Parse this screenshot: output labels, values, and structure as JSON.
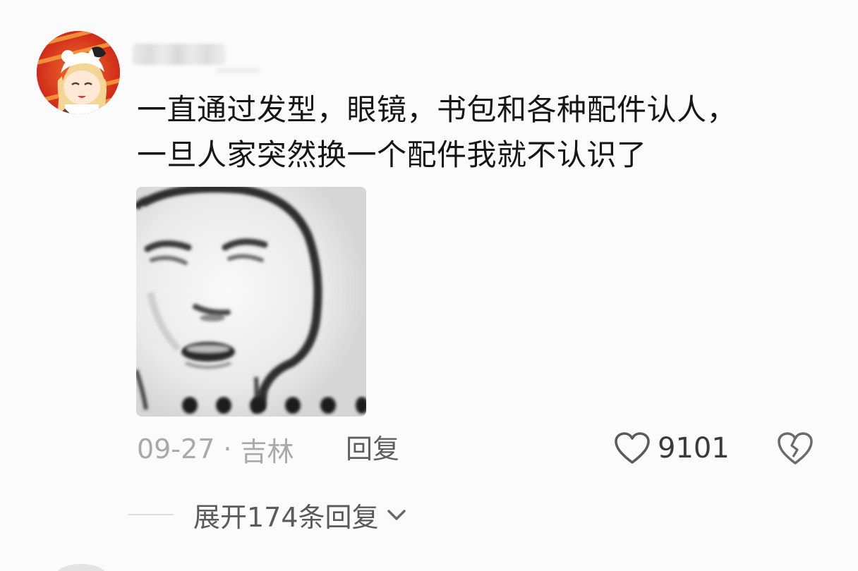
{
  "comment": {
    "avatar_icon": "anime-girl-avatar-icon",
    "username": "",
    "text_line1": "一直通过发型，眼镜，书包和各种配件认人，",
    "text_line2": "一旦人家突然换一个配件我就不认识了",
    "image_icon": "meme-face-image",
    "date": "09-27",
    "separator": "·",
    "location": "吉林",
    "reply_label": "回复",
    "like_icon": "heart-outline-icon",
    "like_count": "9101",
    "dislike_icon": "broken-heart-icon",
    "expand_label": "展开174条回复",
    "expand_icon": "chevron-down-icon"
  },
  "colors": {
    "background": "#fbfbfb",
    "text_primary": "#161616",
    "text_secondary": "#a9a9a9",
    "action_text": "#5f5f5f"
  }
}
